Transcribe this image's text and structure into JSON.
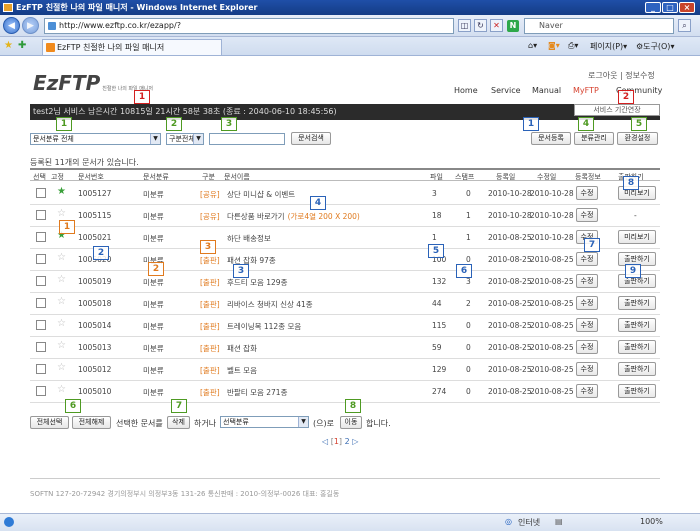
{
  "window": {
    "title": "EzFTP 친절한 나의 파일 매니저 - Windows Internet Explorer"
  },
  "browser": {
    "url": "http://www.ezftp.co.kr/ezapp/?",
    "search_placeholder": "Naver",
    "tab_title": "EzFTP 친절한 나의 파일 매니저",
    "toolbar": {
      "page": "페이지(P)",
      "tools": "도구(O)"
    }
  },
  "site": {
    "logo": "EzFTP",
    "logo_sub": "친절한 나의 파일 매니저",
    "top_links": {
      "logout": "로그아웃",
      "sep": "|",
      "info": "정보수정"
    },
    "nav": [
      "Home",
      "Service",
      "Manual",
      "MyFTP",
      "Community"
    ],
    "service_button": "서비스 기간연장",
    "status_bar_text": "test2님 서비스 남은시간   10815일 21시간 58분 38초 (종료 : 2040-06-10 18:45:56)"
  },
  "filters": {
    "category_select": "문서분류 전체",
    "type_select": "구분전체",
    "search_value": "",
    "search_button": "문서검색"
  },
  "right_buttons": {
    "register": "문서등록",
    "manage": "분류관리",
    "settings": "환경설정"
  },
  "count_text": "등록된 11개의 문서가 있습니다.",
  "table": {
    "headers": [
      "선택",
      "고정",
      "문서번호",
      "문서분류",
      "구분",
      "문서이름",
      "파일",
      "스탬프",
      "등록일",
      "수정일",
      "등록정보",
      "출판하기"
    ],
    "rows": [
      {
        "no": "1005127",
        "pinned": true,
        "category": "미분류",
        "tag": "[공유]",
        "name": "상단 미니샵 & 이벤트",
        "extra": "",
        "files": "3",
        "stamp": "0",
        "reg": "2010-10-28",
        "mod": "2010-10-28",
        "edit": "수정",
        "action": "미리보기"
      },
      {
        "no": "1005115",
        "pinned": false,
        "category": "미분류",
        "tag": "[공유]",
        "name": "다른상품 바로가기",
        "extra": "(가로4열 200 X 200)",
        "files": "18",
        "stamp": "1",
        "reg": "2010-10-28",
        "mod": "2010-10-28",
        "edit": "수정",
        "action": "-"
      },
      {
        "no": "1005021",
        "pinned": true,
        "category": "미분류",
        "tag": "",
        "name": "하단 배송정보",
        "extra": "",
        "files": "1",
        "stamp": "1",
        "reg": "2010-08-25",
        "mod": "2010-10-28",
        "edit": "수정",
        "action": "미리보기"
      },
      {
        "no": "1005020",
        "pinned": false,
        "category": "미분류",
        "tag": "[출판]",
        "name": "패션 잡화 97종",
        "extra": "",
        "files": "100",
        "stamp": "0",
        "reg": "2010-08-25",
        "mod": "2010-08-25",
        "edit": "수정",
        "action": "출판하기"
      },
      {
        "no": "1005019",
        "pinned": false,
        "category": "미분류",
        "tag": "[출판]",
        "name": "후드티 모음 129종",
        "extra": "",
        "files": "132",
        "stamp": "3",
        "reg": "2010-08-25",
        "mod": "2010-08-25",
        "edit": "수정",
        "action": "출판하기"
      },
      {
        "no": "1005018",
        "pinned": false,
        "category": "미분류",
        "tag": "[출판]",
        "name": "리바이스 청바지 신상 41종",
        "extra": "",
        "files": "44",
        "stamp": "2",
        "reg": "2010-08-25",
        "mod": "2010-08-25",
        "edit": "수정",
        "action": "출판하기"
      },
      {
        "no": "1005014",
        "pinned": false,
        "category": "미분류",
        "tag": "[출판]",
        "name": "트레이닝복 112종 모음",
        "extra": "",
        "files": "115",
        "stamp": "0",
        "reg": "2010-08-25",
        "mod": "2010-08-25",
        "edit": "수정",
        "action": "출판하기"
      },
      {
        "no": "1005013",
        "pinned": false,
        "category": "미분류",
        "tag": "[출판]",
        "name": "패션 잡화",
        "extra": "",
        "files": "59",
        "stamp": "0",
        "reg": "2010-08-25",
        "mod": "2010-08-25",
        "edit": "수정",
        "action": "출판하기"
      },
      {
        "no": "1005012",
        "pinned": false,
        "category": "미분류",
        "tag": "[출판]",
        "name": "벨트 모음",
        "extra": "",
        "files": "129",
        "stamp": "0",
        "reg": "2010-08-25",
        "mod": "2010-08-25",
        "edit": "수정",
        "action": "출판하기"
      },
      {
        "no": "1005010",
        "pinned": false,
        "category": "미분류",
        "tag": "[출판]",
        "name": "반팔티 모음 271종",
        "extra": "",
        "files": "274",
        "stamp": "0",
        "reg": "2010-08-25",
        "mod": "2010-08-25",
        "edit": "수정",
        "action": "출판하기"
      }
    ]
  },
  "bottom": {
    "select_all": "전체선택",
    "deselect_all": "전체해제",
    "selected_docs": "선택한 문서를",
    "delete": "삭제",
    "or": "하거나",
    "move_select": "선택분류",
    "to": "(으)로",
    "move": "이동",
    "do": "합니다."
  },
  "pagination": {
    "prev": "◁",
    "page1": "1",
    "page2": "2",
    "next": "▷"
  },
  "footer": "SOFTN 127-20-72942 경기의정부시 의정부3동 131-26 통신판매 : 2010-의정부-0026 대표: 홍길동",
  "statusbar": {
    "zone": "인터넷",
    "zoom": "100%"
  },
  "callouts": {
    "red": [
      "1",
      "2"
    ],
    "green": [
      "1",
      "2",
      "3",
      "5",
      "6",
      "7",
      "8"
    ],
    "blue": [
      "1",
      "2",
      "3",
      "4",
      "5",
      "6",
      "7",
      "8",
      "9"
    ],
    "orange": [
      "1",
      "2",
      "3",
      "4"
    ]
  }
}
